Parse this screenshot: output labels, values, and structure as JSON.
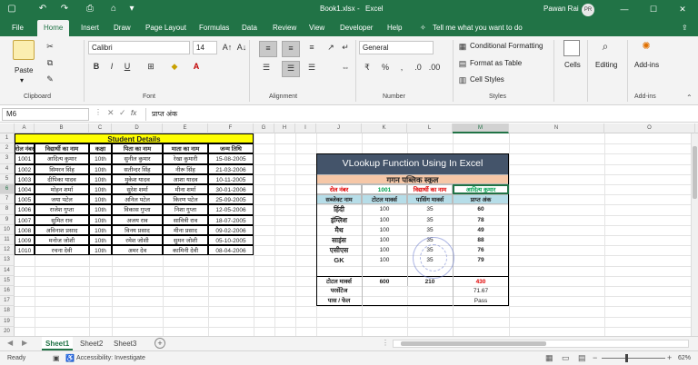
{
  "titlebar": {
    "file_name": "Book1.xlsx",
    "dash": "-",
    "app_name": "Excel",
    "user_name": "Pawan Rai",
    "avatar_initials": "PR",
    "accent": "#217346"
  },
  "ribbon_tabs": [
    "File",
    "Home",
    "Insert",
    "Draw",
    "Page Layout",
    "Formulas",
    "Data",
    "Review",
    "View",
    "Developer",
    "Help"
  ],
  "tell_me": "Tell me what you want to do",
  "ribbon": {
    "paste": "Paste",
    "clipboard": "Clipboard",
    "font_name": "Calibri",
    "font_size": "14",
    "font": "Font",
    "alignment": "Alignment",
    "number_format": "General",
    "number": "Number",
    "conditional_formatting": "Conditional Formatting",
    "format_as_table": "Format as Table",
    "cell_styles": "Cell Styles",
    "styles": "Styles",
    "cells": "Cells",
    "editing": "Editing",
    "addins_button": "Add-ins",
    "addins_group": "Add-ins"
  },
  "formula_bar": {
    "name_box": "M6",
    "fx": "fx",
    "content": "प्राप्त अंक"
  },
  "columns": [
    "A",
    "B",
    "C",
    "D",
    "E",
    "F",
    "G",
    "H",
    "I",
    "J",
    "K",
    "L",
    "M",
    "N",
    "O"
  ],
  "rows": [
    "1",
    "2",
    "3",
    "4",
    "5",
    "6",
    "7",
    "8",
    "9",
    "10",
    "11",
    "12",
    "13",
    "14",
    "15",
    "16",
    "17",
    "18",
    "19",
    "20"
  ],
  "student_table": {
    "title": "Student Details",
    "headers": [
      "रोल नंबर",
      "विद्यार्थी का नाम",
      "कक्षा",
      "पिता का नाम",
      "माता का नाम",
      "जन्म तिथि"
    ],
    "rows": [
      [
        "1001",
        "आदित्य कुमार",
        "10th",
        "सुनील कुमार",
        "रेखा कुमारी",
        "15-08-2005"
      ],
      [
        "1002",
        "सिमरन सिंह",
        "10th",
        "सतीन्दर सिंह",
        "नीरू सिंह",
        "21-03-2006"
      ],
      [
        "1003",
        "दीपिका यादव",
        "10th",
        "मुकेश यादव",
        "आशा यादव",
        "10-11-2005"
      ],
      [
        "1004",
        "मोहन शर्मा",
        "10th",
        "सुरेश शर्मा",
        "मीना शर्मा",
        "30-01-2006"
      ],
      [
        "1005",
        "जया पटेल",
        "10th",
        "अनिल पटेल",
        "किरण पटेल",
        "25-09-2005"
      ],
      [
        "1006",
        "राजेश गुप्ता",
        "10th",
        "विकास गुप्ता",
        "निशा गुप्ता",
        "12-05-2006"
      ],
      [
        "1007",
        "सुमित राव",
        "10th",
        "अजय राव",
        "सावित्री राव",
        "18-07-2005"
      ],
      [
        "1008",
        "अविनाश प्रसाद",
        "10th",
        "विनय प्रसाद",
        "मीना प्रसाद",
        "09-02-2006"
      ],
      [
        "1009",
        "मनोज जोशी",
        "10th",
        "रमेश जोशी",
        "सुमन जोशी",
        "05-10-2005"
      ],
      [
        "1010",
        "रचना देवी",
        "10th",
        "अमर देव",
        "कामिनी देवी",
        "08-04-2006"
      ]
    ]
  },
  "report_card": {
    "banner": "VLookup Function Using In Excel",
    "school": "गगन पब्लिक स्कूल",
    "roll_label": "रोल नंबर",
    "roll_value": "1001",
    "student_label": "विद्यार्थी का नाम",
    "student_value": "आदित्य कुमार",
    "headers": [
      "सब्जेक्ट नाम",
      "टोटल मार्क्स",
      "पासिंग मार्क्स",
      "प्राप्त अंक"
    ],
    "subjects": [
      [
        "हिंदी",
        "100",
        "35",
        "60"
      ],
      [
        "इंग्लिश",
        "100",
        "35",
        "78"
      ],
      [
        "मैथ",
        "100",
        "35",
        "49"
      ],
      [
        "साइंस",
        "100",
        "35",
        "88"
      ],
      [
        "एसीएस",
        "100",
        "35",
        "76"
      ],
      [
        "GK",
        "100",
        "35",
        "79"
      ]
    ],
    "total_label": "टोटल मार्क्स",
    "total_max": "600",
    "total_passing": "210",
    "total_obtained": "430",
    "percent_label": "परसेंटेज",
    "percent_value": "71.67",
    "result_label": "पास / फेल",
    "result_value": "Pass"
  },
  "sheets": [
    "Sheet1",
    "Sheet2",
    "Sheet3"
  ],
  "status": {
    "ready": "Ready",
    "accessibility": "Accessibility: Investigate",
    "zoom": "62%"
  }
}
